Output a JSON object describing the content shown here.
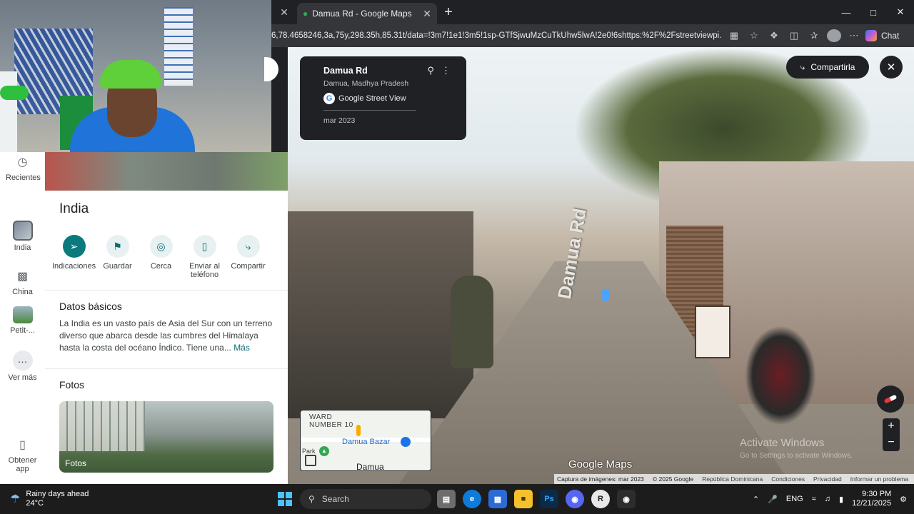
{
  "browser": {
    "tab_title": "Damua Rd - Google Maps",
    "url": "6,78.4658246,3a,75y,298.35h,85.31t/data=!3m7!1e1!3m5!1sp-GTfSjwuMzCuTkUhw5lwA!2e0!6shttps:%2F%2Fstreetviewpi...",
    "chat_label": "Chat",
    "new_tab": "+",
    "tab_close": "✕"
  },
  "rail": {
    "items": [
      {
        "label": "Recientes",
        "icon": "history-icon"
      },
      {
        "label": "India",
        "icon": "thumbnail"
      },
      {
        "label": "China",
        "icon": "thumbnail"
      },
      {
        "label": "Petit-...",
        "icon": "thumbnail"
      },
      {
        "label": "Ver más",
        "icon": "more-icon"
      },
      {
        "label": "Obtener app",
        "icon": "phone-icon"
      }
    ]
  },
  "panel": {
    "title": "India",
    "actions": [
      {
        "label": "Indicaciones",
        "icon": "directions-icon"
      },
      {
        "label": "Guardar",
        "icon": "bookmark-icon"
      },
      {
        "label": "Cerca",
        "icon": "nearby-icon"
      },
      {
        "label": "Enviar al teléfono",
        "icon": "send-to-phone-icon"
      },
      {
        "label": "Compartir",
        "icon": "share-icon"
      }
    ],
    "basics_heading": "Datos básicos",
    "description": "La India es un vasto país de Asia del Sur con un terreno diverso que abarca desde las cumbres del Himalaya hasta la costa del océano Índico. Tiene una...",
    "more_link": "Más",
    "photos_heading": "Fotos",
    "photo_label": "Fotos"
  },
  "streetview": {
    "card_title": "Damua Rd",
    "card_subtitle": "Damua, Madhya Pradesh",
    "card_brand": "Google Street View",
    "card_date": "mar 2023",
    "share_label": "Compartirla",
    "road_text": "Damua Rd",
    "minimap": {
      "ward": "WARD",
      "number": "NUMBER 10",
      "bazar": "Damua Bazar",
      "town": "Damua",
      "park": "Park"
    },
    "logo": "Google Maps",
    "footer": [
      "Captura de imágenes: mar 2023",
      "© 2025 Google",
      "República Dominicana",
      "Condiciones",
      "Privacidad",
      "Informar un problema"
    ],
    "activate_title": "Activate Windows",
    "activate_sub": "Go to Settings to activate Windows."
  },
  "taskbar": {
    "weather_title": "Rainy days ahead",
    "weather_temp": "24°C",
    "search_placeholder": "Search",
    "lang": "ENG",
    "time": "9:30 PM",
    "date": "12/21/2025"
  }
}
